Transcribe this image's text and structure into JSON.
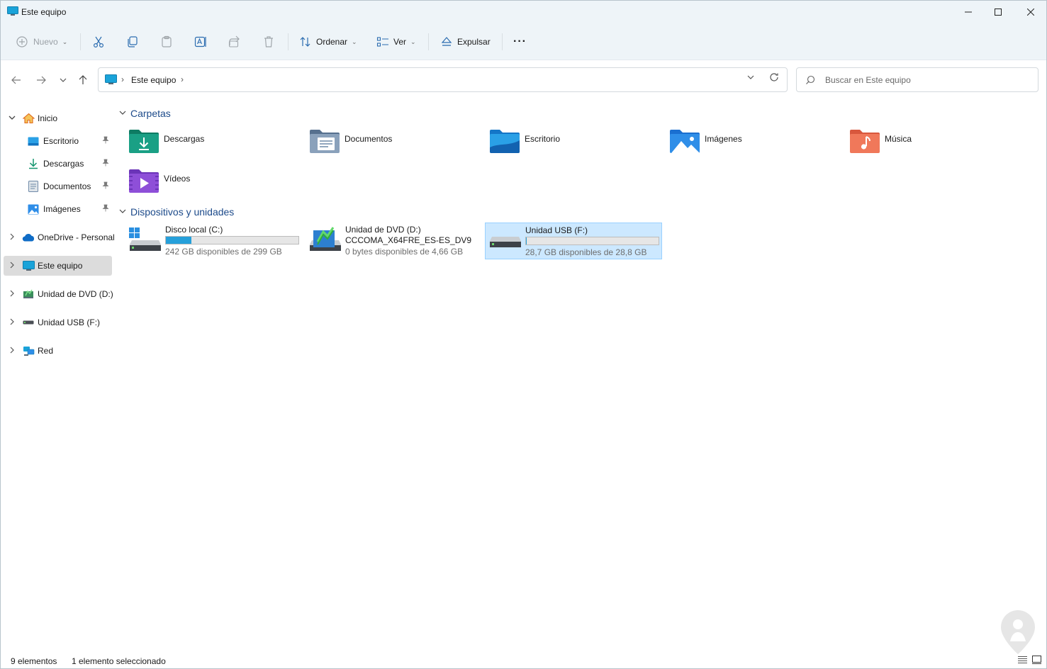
{
  "window": {
    "title": "Este equipo"
  },
  "toolbar": {
    "new_label": "Nuevo",
    "sort_label": "Ordenar",
    "view_label": "Ver",
    "eject_label": "Expulsar",
    "more_label": "···"
  },
  "address": {
    "crumb": "Este equipo"
  },
  "search": {
    "placeholder": "Buscar en Este equipo"
  },
  "sidebar": {
    "items": [
      {
        "label": "Inicio"
      },
      {
        "label": "Escritorio"
      },
      {
        "label": "Descargas"
      },
      {
        "label": "Documentos"
      },
      {
        "label": "Imágenes"
      },
      {
        "label": "OneDrive - Personal"
      },
      {
        "label": "Este equipo"
      },
      {
        "label": "Unidad de DVD (D:)"
      },
      {
        "label": "Unidad USB (F:)"
      },
      {
        "label": "Red"
      }
    ]
  },
  "sections": {
    "folders_title": "Carpetas",
    "devices_title": "Dispositivos y unidades"
  },
  "folders": [
    {
      "label": "Descargas",
      "icon": "downloads-folder-icon",
      "color": "#1aa085"
    },
    {
      "label": "Documentos",
      "icon": "documents-folder-icon",
      "color": "#6f8aa8"
    },
    {
      "label": "Escritorio",
      "icon": "desktop-folder-icon",
      "color": "#2aa0e6"
    },
    {
      "label": "Imágenes",
      "icon": "pictures-folder-icon",
      "color": "#2f8ee8"
    },
    {
      "label": "Música",
      "icon": "music-folder-icon",
      "color": "#f0785a"
    },
    {
      "label": "Vídeos",
      "icon": "videos-folder-icon",
      "color": "#8e4fd8"
    }
  ],
  "drives": [
    {
      "name": "Disco local (C:)",
      "free": "242 GB disponibles de 299 GB",
      "used_fraction": 0.19
    },
    {
      "name": "Unidad de DVD (D:)",
      "sub": "CCCOMA_X64FRE_ES-ES_DV9",
      "free": "0 bytes disponibles de 4,66 GB"
    },
    {
      "name": "Unidad USB (F:)",
      "free": "28,7 GB disponibles de 28,8 GB",
      "used_fraction": 0.004
    }
  ],
  "status": {
    "count": "9 elementos",
    "selection": "1 elemento seleccionado"
  },
  "colors": {
    "accent": "#26a0da",
    "selection_bg": "#cce8ff",
    "section_header": "#1c4a8a"
  }
}
